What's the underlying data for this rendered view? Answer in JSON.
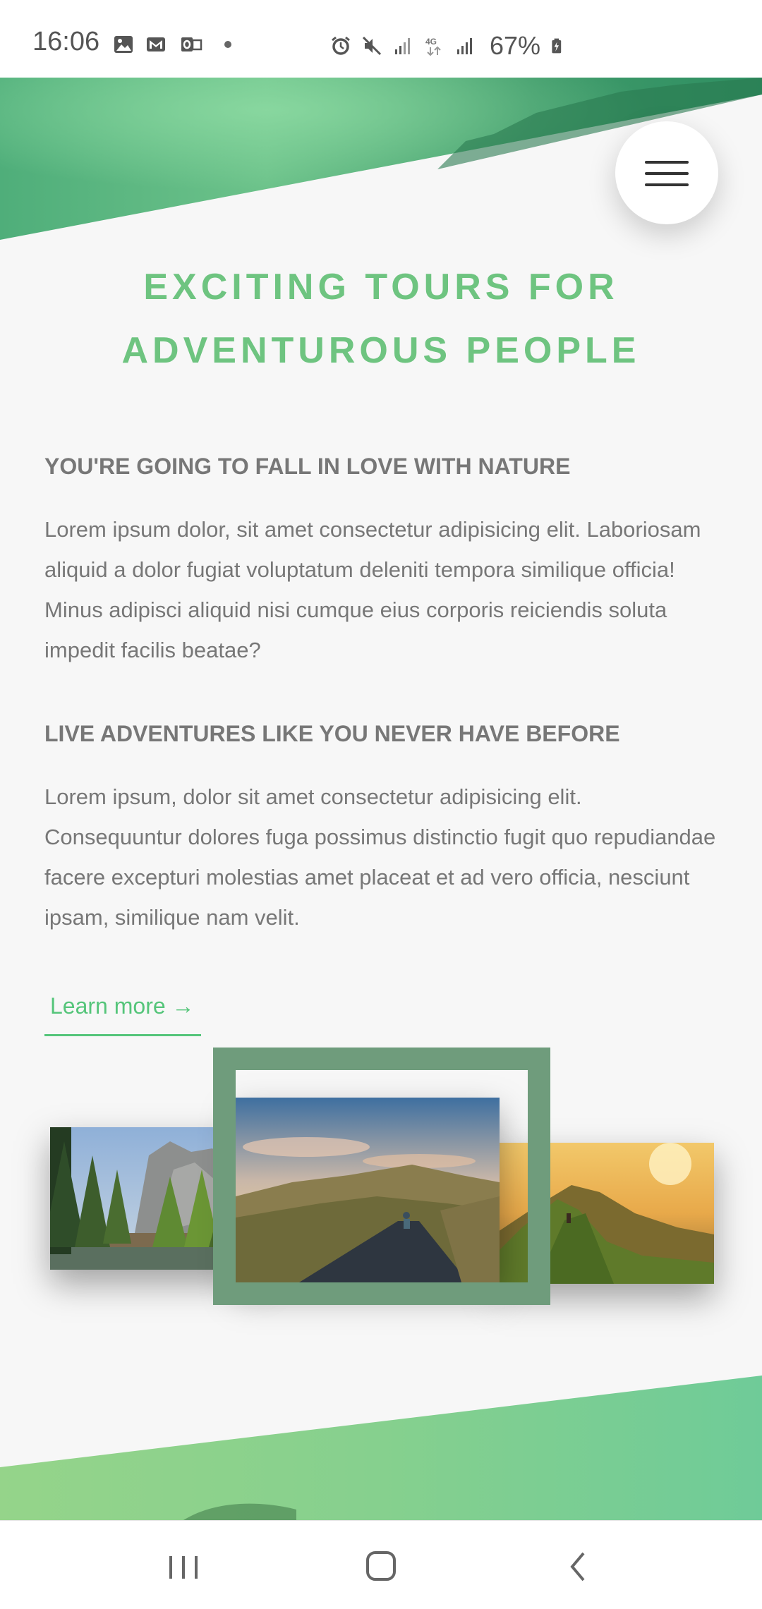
{
  "status_bar": {
    "time": "16:06",
    "left_icons": [
      "gallery-icon",
      "gmail-icon",
      "outlook-icon",
      "dot-icon"
    ],
    "right_icons": [
      "alarm-icon",
      "mute-icon",
      "signal-icon",
      "4g-icon",
      "signal-icon",
      "battery-icon"
    ],
    "network": "4G",
    "battery": "67%"
  },
  "menu": {
    "icon": "hamburger-menu-icon"
  },
  "hero": {
    "title_line1": "EXCITING TOURS FOR",
    "title_line2": "ADVENTUROUS PEOPLE"
  },
  "section1": {
    "heading": "YOU'RE GOING TO FALL IN LOVE WITH NATURE",
    "body": "Lorem ipsum dolor, sit amet consectetur adipisicing elit. Laboriosam aliquid a dolor fugiat voluptatum deleniti tempora similique officia! Minus adipisci aliquid nisi cumque eius corporis reiciendis soluta impedit facilis beatae?"
  },
  "section2": {
    "heading": "LIVE ADVENTURES LIKE YOU NEVER HAVE BEFORE",
    "body": "Lorem ipsum, dolor sit amet consectetur adipisicing elit. Consequuntur dolores fuga possimus distinctio fugit quo repudiandae facere excepturi molestias amet placeat et ad vero officia, nesciunt ipsam, similique nam velit."
  },
  "cta": {
    "label": "Learn more →"
  },
  "photos": [
    "forest-river-photo",
    "hiker-road-photo",
    "mountain-ridge-photo"
  ],
  "colors": {
    "primary": "#55c57a",
    "primary_light": "#7ed56f",
    "primary_dark": "#28b485",
    "frame": "#6f9c7c",
    "text": "#777777",
    "background": "#f7f7f7"
  },
  "nav_bar": {
    "buttons": [
      "recent-apps-icon",
      "home-icon",
      "back-icon"
    ]
  }
}
